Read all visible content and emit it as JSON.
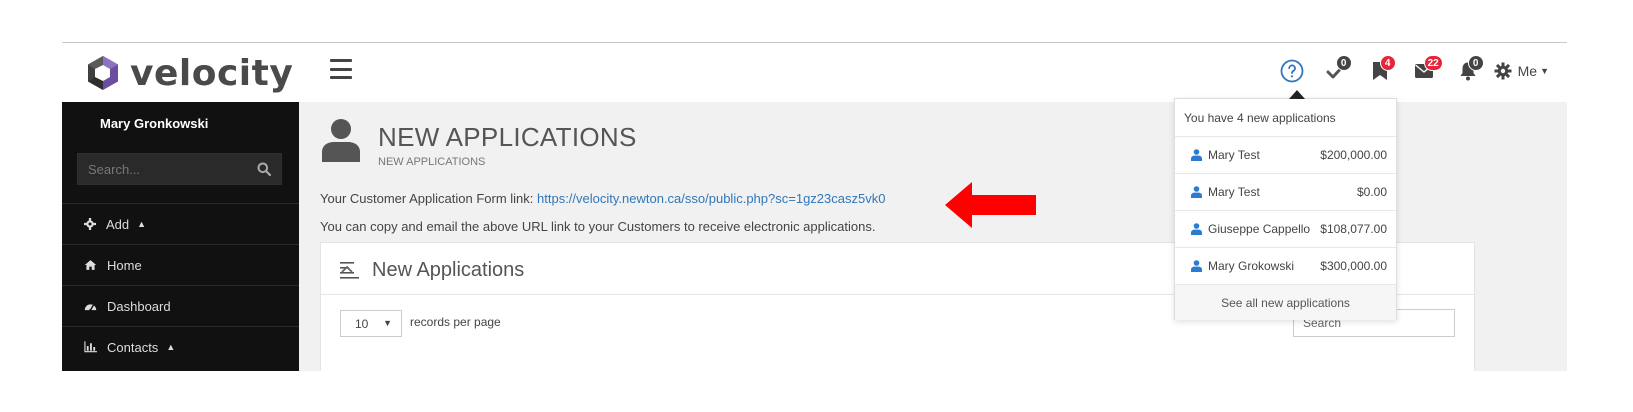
{
  "brand": {
    "name": "velocity"
  },
  "nav": {
    "tasks_count": "0",
    "applications_count": "4",
    "messages_count": "22",
    "alerts_count": "0",
    "me_label": "Me"
  },
  "sidebar": {
    "user_name": "Mary Gronkowski",
    "search_placeholder": "Search...",
    "items": [
      {
        "label": "Add",
        "icon": "gear-icon"
      },
      {
        "label": "Home",
        "icon": "home-icon"
      },
      {
        "label": "Dashboard",
        "icon": "dashboard-icon"
      },
      {
        "label": "Contacts",
        "icon": "chart-icon"
      }
    ]
  },
  "page": {
    "title": "NEW APPLICATIONS",
    "subtitle": "NEW APPLICATIONS",
    "form_link_prefix": "Your Customer Application Form link: ",
    "form_link_url": "https://velocity.newton.ca/sso/public.php?sc=1gz23casz5vk0",
    "copy_hint": "You can copy and email the above URL link to your Customers to receive electronic applications."
  },
  "panel": {
    "title": "New Applications",
    "page_length": "10",
    "records_label": "records per page",
    "search_placeholder": "Search"
  },
  "dropdown": {
    "header": "You have 4 new applications",
    "items": [
      {
        "name": "Mary Test",
        "amount": "$200,000.00"
      },
      {
        "name": "Mary Test",
        "amount": "$0.00"
      },
      {
        "name": "Giuseppe Cappello",
        "amount": "$108,077.00"
      },
      {
        "name": "Mary Grokowski",
        "amount": "$300,000.00"
      }
    ],
    "footer": "See all new applications"
  },
  "colors": {
    "accent_blue": "#3277b8",
    "badge_red": "#e8243c",
    "sidebar_bg": "#111111",
    "annotation_arrow": "#ff0000"
  }
}
